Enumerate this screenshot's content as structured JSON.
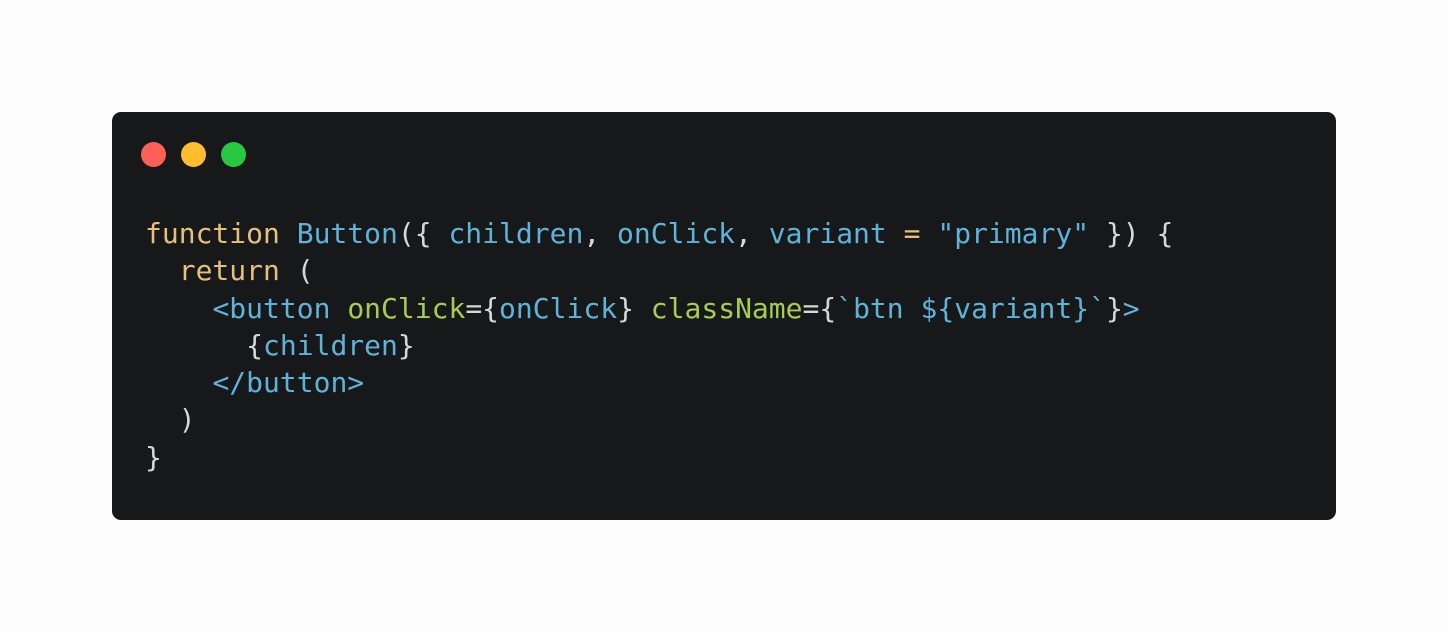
{
  "colors": {
    "page_background": "#fdfdfd",
    "window_background": "#16181a",
    "keyword": "#e5c07b",
    "identifier": "#5fb3d9",
    "attribute": "#a6cc54",
    "punctuation": "#d7d7d7",
    "close_dot": "#fe5f57",
    "minimize_dot": "#febc2e",
    "zoom_dot": "#28c840"
  },
  "window_controls": [
    {
      "name": "close-dot",
      "color": "#fe5f57"
    },
    {
      "name": "minimize-dot",
      "color": "#febc2e"
    },
    {
      "name": "zoom-dot",
      "color": "#28c840"
    }
  ],
  "code_lines": [
    [
      {
        "text": "function",
        "role": "keyword"
      },
      {
        "text": " ",
        "role": "punctuation"
      },
      {
        "text": "Button",
        "role": "identifier"
      },
      {
        "text": "({ ",
        "role": "punctuation"
      },
      {
        "text": "children",
        "role": "identifier"
      },
      {
        "text": ", ",
        "role": "punctuation"
      },
      {
        "text": "onClick",
        "role": "identifier"
      },
      {
        "text": ", ",
        "role": "punctuation"
      },
      {
        "text": "variant",
        "role": "identifier"
      },
      {
        "text": " = ",
        "role": "keyword"
      },
      {
        "text": "\"primary\"",
        "role": "identifier"
      },
      {
        "text": " }) {",
        "role": "punctuation"
      }
    ],
    [
      {
        "text": "  ",
        "role": "punctuation"
      },
      {
        "text": "return",
        "role": "keyword"
      },
      {
        "text": " (",
        "role": "punctuation"
      }
    ],
    [
      {
        "text": "    ",
        "role": "punctuation"
      },
      {
        "text": "<button",
        "role": "identifier"
      },
      {
        "text": " ",
        "role": "punctuation"
      },
      {
        "text": "onClick",
        "role": "attribute"
      },
      {
        "text": "={",
        "role": "punctuation"
      },
      {
        "text": "onClick",
        "role": "identifier"
      },
      {
        "text": "} ",
        "role": "punctuation"
      },
      {
        "text": "className",
        "role": "attribute"
      },
      {
        "text": "={",
        "role": "punctuation"
      },
      {
        "text": "`btn ${variant}`",
        "role": "identifier"
      },
      {
        "text": "}",
        "role": "punctuation"
      },
      {
        "text": ">",
        "role": "identifier"
      }
    ],
    [
      {
        "text": "      {",
        "role": "punctuation"
      },
      {
        "text": "children",
        "role": "identifier"
      },
      {
        "text": "}",
        "role": "punctuation"
      }
    ],
    [
      {
        "text": "    ",
        "role": "punctuation"
      },
      {
        "text": "</button>",
        "role": "identifier"
      }
    ],
    [
      {
        "text": "  )",
        "role": "punctuation"
      }
    ],
    [
      {
        "text": "}",
        "role": "punctuation"
      }
    ]
  ]
}
